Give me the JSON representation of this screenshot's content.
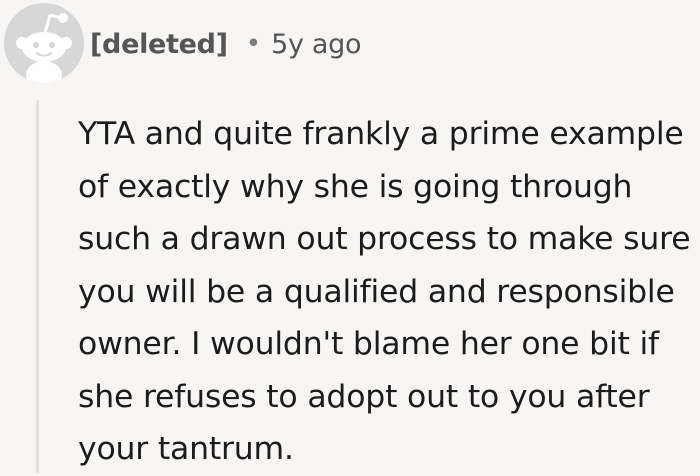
{
  "comment": {
    "author": "[deleted]",
    "separator": "•",
    "timestamp": "5y ago",
    "avatar_icon": "deleted-user-snoo-icon",
    "body": "YTA and quite frankly a prime example of exactly why she is going through such a drawn out process to make sure you will be a qualified and responsible owner. I wouldn't blame her one bit if she refuses to adopt out to you after your tantrum."
  }
}
